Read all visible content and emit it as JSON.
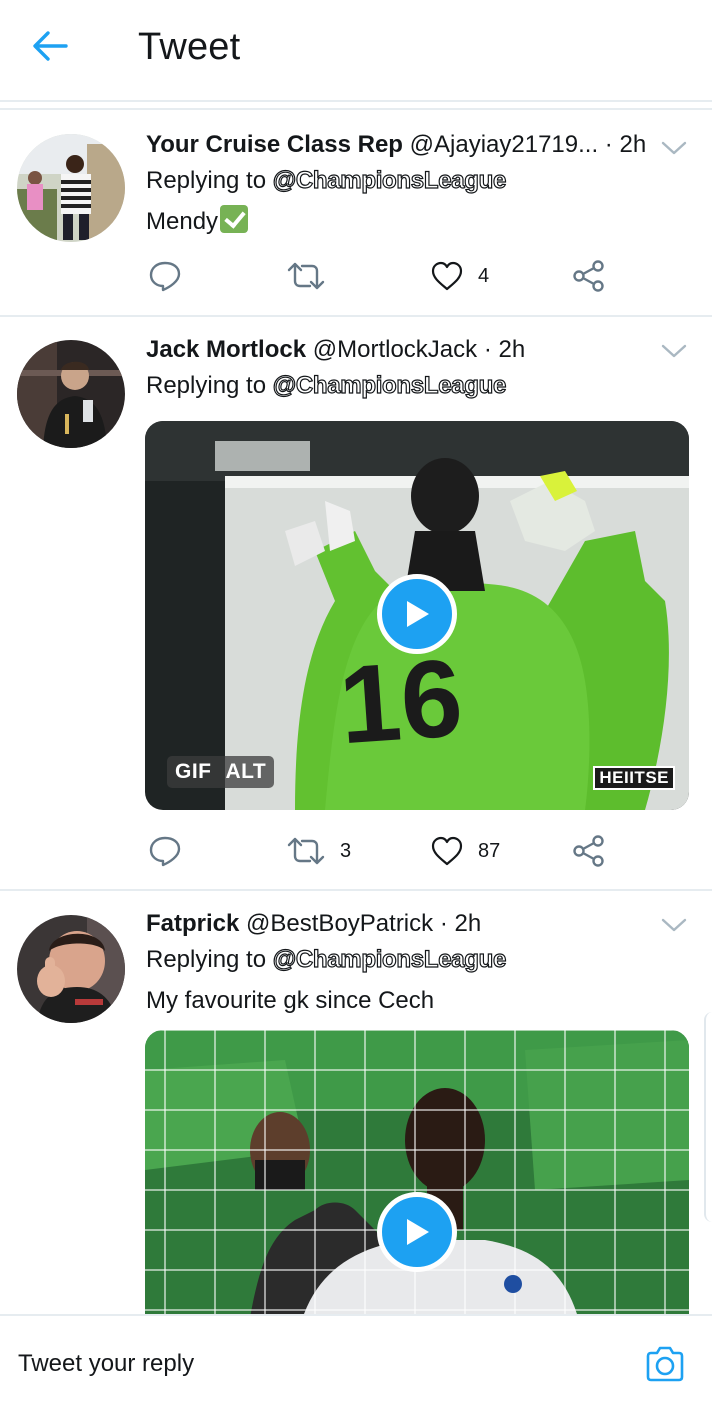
{
  "header": {
    "title": "Tweet"
  },
  "tweets": [
    {
      "name": "Your Cruise Class Rep",
      "handle": "@Ajayiay21719...",
      "dot": "·",
      "time": "2h",
      "replying_prefix": "Replying to",
      "mention": "@ChampionsLeague",
      "text": "Mendy",
      "emoji": "white-check-mark",
      "actions": {
        "reply": "",
        "retweet": "",
        "like": "4"
      }
    },
    {
      "name": "Jack Mortlock",
      "handle": "@MortlockJack",
      "dot": "·",
      "time": "2h",
      "replying_prefix": "Replying to",
      "mention": "@ChampionsLeague",
      "media": {
        "badge_gif": "GIF",
        "badge_alt": "ALT",
        "watermark": "HEIITSE"
      },
      "actions": {
        "reply": "",
        "retweet": "3",
        "like": "87"
      }
    },
    {
      "name": "Fatprick",
      "handle": "@BestBoyPatrick",
      "dot": "·",
      "time": "2h",
      "replying_prefix": "Replying to",
      "mention": "@ChampionsLeague",
      "text": "My favourite gk since Cech"
    }
  ],
  "reply_bar": {
    "placeholder": "Tweet your reply"
  },
  "colors": {
    "accent": "#1da1f2",
    "icon_gray": "#657786",
    "divider": "#e6ecf0",
    "like_icon": "#14171a"
  },
  "icons": [
    "back-arrow-icon",
    "chevron-down-icon",
    "reply-icon",
    "retweet-icon",
    "heart-icon",
    "share-icon",
    "play-icon",
    "camera-icon"
  ]
}
